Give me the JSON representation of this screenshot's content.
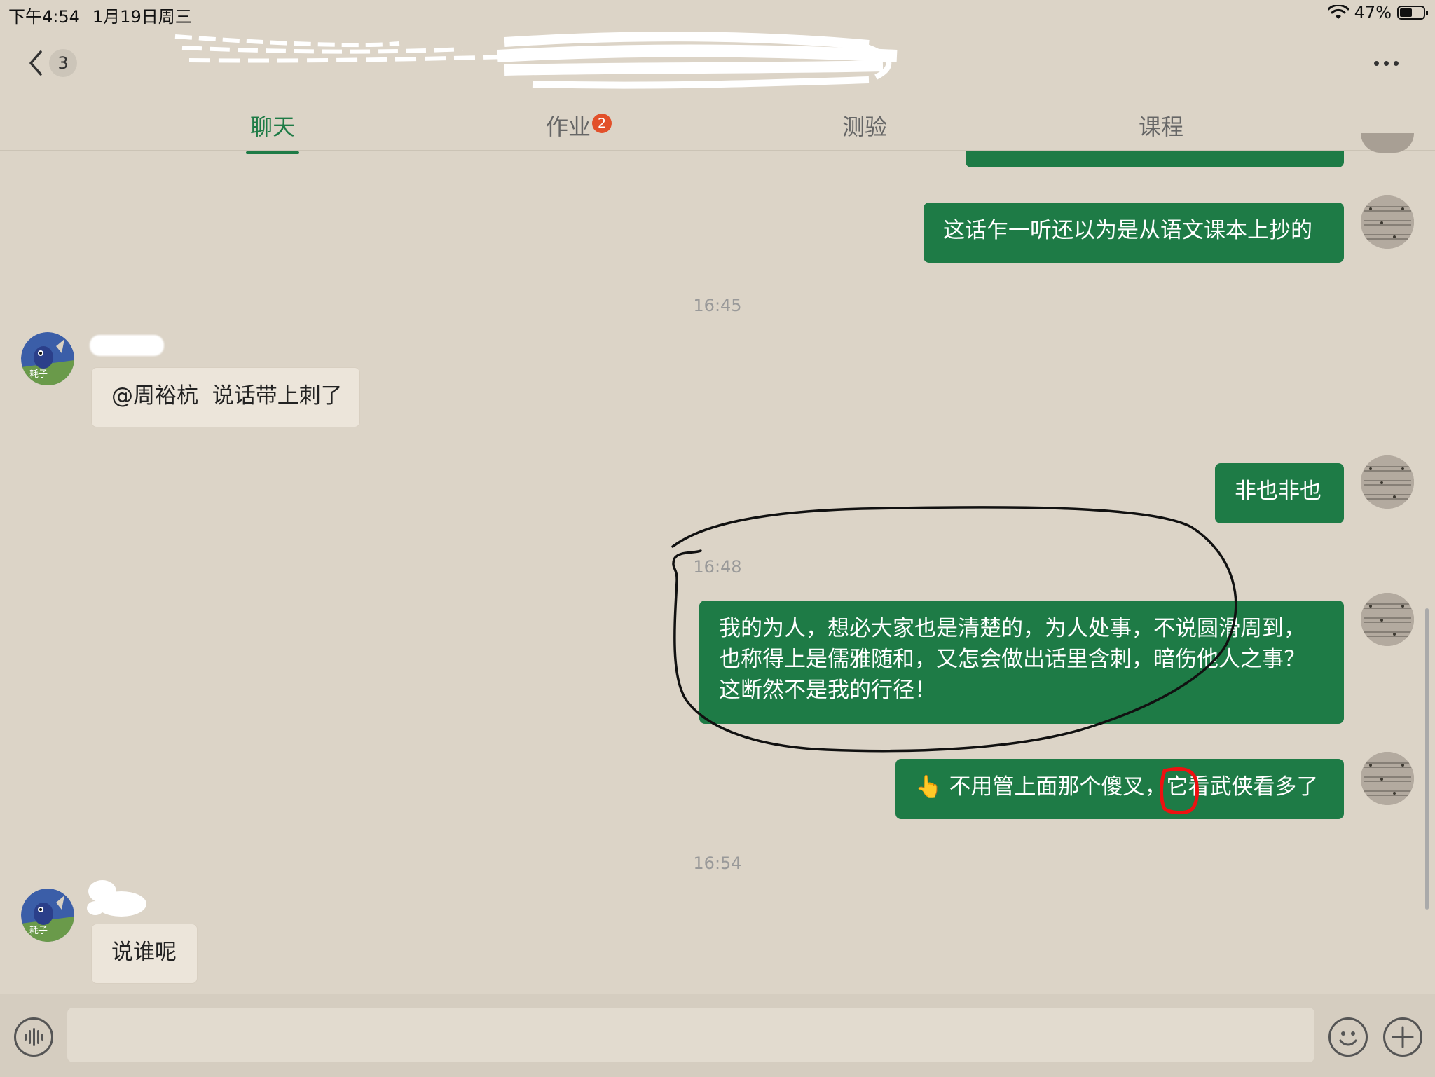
{
  "status_bar": {
    "time": "下午4:54",
    "date": "1月19日周三",
    "battery": "47%",
    "wifi_icon": "wifi-icon",
    "battery_icon": "battery-icon"
  },
  "header": {
    "back_count": "3",
    "back_icon": "chevron-left-icon",
    "more_icon": "more-dots-icon"
  },
  "tabs": [
    {
      "label": "聊天",
      "active": true
    },
    {
      "label": "作业",
      "badge": "2"
    },
    {
      "label": "测验"
    },
    {
      "label": "课程"
    }
  ],
  "messages": {
    "out_1": "这话乍一听还以为是从语文课本上抄的",
    "time_1": "16:45",
    "in_1": "@周裕杭  说话带上刺了",
    "out_2": "非也非也",
    "time_2": "16:48",
    "out_3": "我的为人，想必大家也是清楚的，为人处事，不说圆滑周到，也称得上是儒雅随和，又怎会做出话里含刺，暗伤他人之事？这断然不是我的行径！",
    "out_4_emoji": "👆",
    "out_4": "不用管上面那个傻叉，它看武侠看多了",
    "time_3": "16:54",
    "in_2": "说谁呢"
  },
  "avatar_caption": "耗子"
}
